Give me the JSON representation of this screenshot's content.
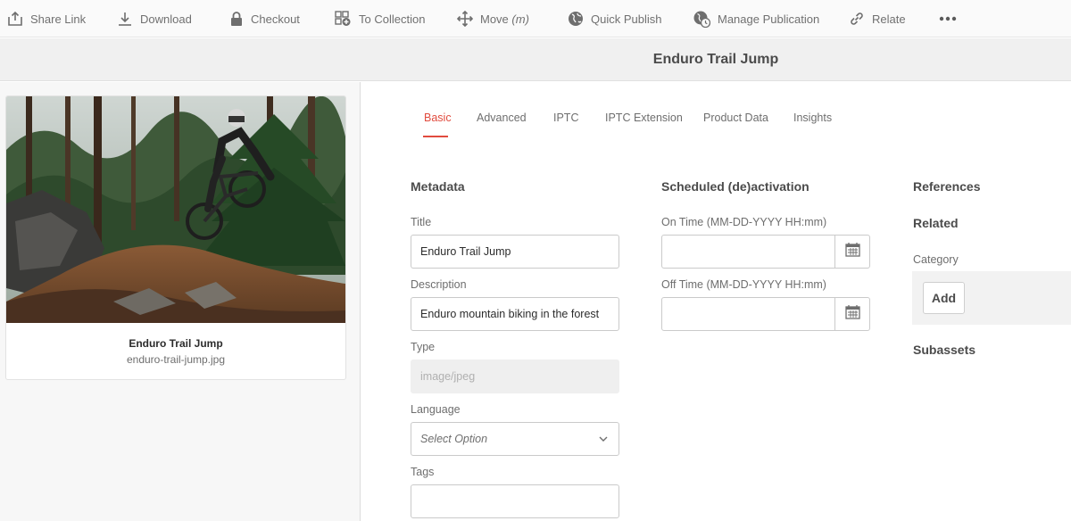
{
  "toolbar": {
    "items": [
      {
        "label": "Share Link",
        "icon": "share-icon"
      },
      {
        "label": "Download",
        "icon": "download-icon"
      },
      {
        "label": "Checkout",
        "icon": "lock-icon"
      },
      {
        "label": "To Collection",
        "icon": "collection-icon"
      },
      {
        "label": "Move",
        "shortcut": "(m)",
        "icon": "move-icon"
      },
      {
        "label": "Quick Publish",
        "icon": "globe-icon"
      },
      {
        "label": "Manage Publication",
        "icon": "globe-clock-icon"
      },
      {
        "label": "Relate",
        "icon": "link-icon"
      }
    ],
    "more_icon": "more-icon"
  },
  "page_title": "Enduro Trail Jump",
  "asset": {
    "name": "Enduro Trail Jump",
    "filename": "enduro-trail-jump.jpg"
  },
  "tabs": [
    "Basic",
    "Advanced",
    "IPTC",
    "IPTC Extension",
    "Product Data",
    "Insights"
  ],
  "active_tab": "Basic",
  "metadata": {
    "heading": "Metadata",
    "title_label": "Title",
    "title_value": "Enduro Trail Jump",
    "description_label": "Description",
    "description_value": "Enduro mountain biking in the forest",
    "type_label": "Type",
    "type_value": "image/jpeg",
    "language_label": "Language",
    "language_placeholder": "Select Option",
    "tags_label": "Tags",
    "tags_value": ""
  },
  "schedule": {
    "heading": "Scheduled (de)activation",
    "on_label": "On Time (MM-DD-YYYY HH:mm)",
    "on_value": "",
    "off_label": "Off Time (MM-DD-YYYY HH:mm)",
    "off_value": ""
  },
  "references": {
    "heading": "References",
    "related_heading": "Related",
    "category_label": "Category",
    "add_label": "Add",
    "subassets_heading": "Subassets"
  },
  "colors": {
    "accent": "#e14b3e",
    "toolbar_bg": "#fafafa",
    "title_bar_bg": "#f0f0f0"
  }
}
